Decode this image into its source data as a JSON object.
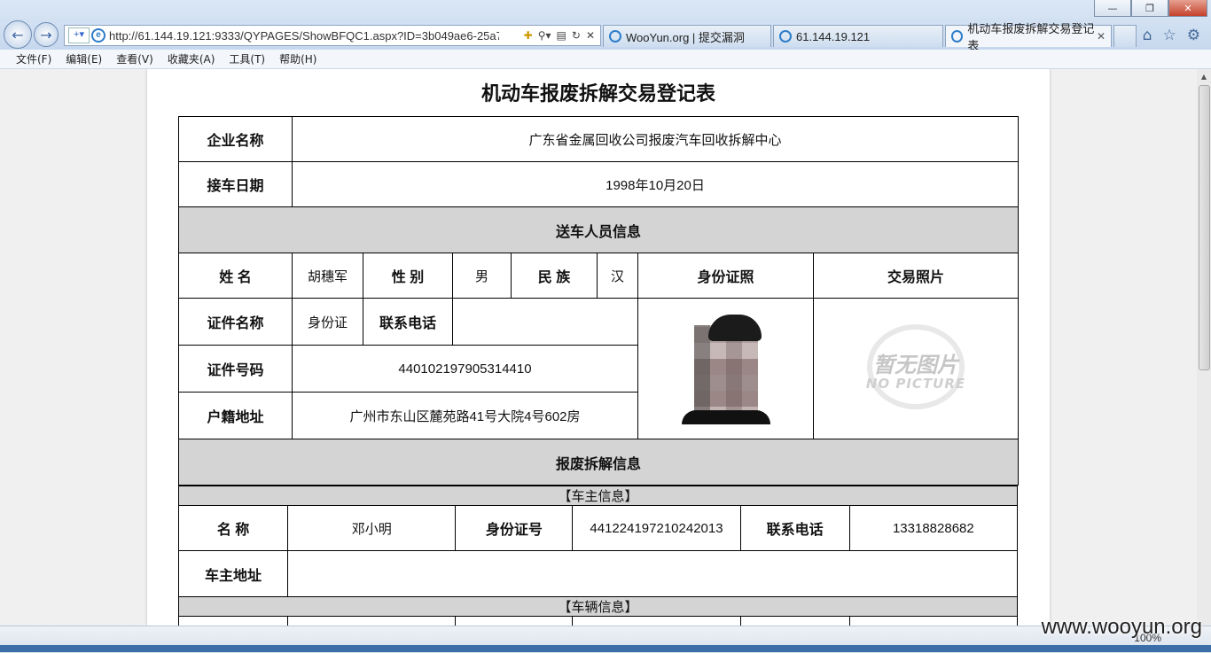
{
  "browser": {
    "url": "http://61.144.19.121:9333/QYPAGES/ShowBFQC1.aspx?ID=3b049ae6-25a7-",
    "tabs": [
      {
        "label": "WooYun.org | 提交漏洞"
      },
      {
        "label": "61.144.19.121"
      },
      {
        "label": "机动车报废拆解交易登记表"
      }
    ],
    "menu": [
      "文件(F)",
      "编辑(E)",
      "查看(V)",
      "收藏夹(A)",
      "工具(T)",
      "帮助(H)"
    ],
    "zoom": "100%"
  },
  "document": {
    "title": "机动车报废拆解交易登记表",
    "company_label": "企业名称",
    "company_value": "广东省金属回收公司报废汽车回收拆解中心",
    "date_label": "接车日期",
    "date_value": "1998年10月20日",
    "sender_section": "送车人员信息",
    "name_label": "姓 名",
    "name_value": "胡穗军",
    "gender_label": "性 别",
    "gender_value": "男",
    "ethnicity_label": "民 族",
    "ethnicity_value": "汉",
    "id_photo_label": "身份证照",
    "trade_photo_label": "交易照片",
    "doc_type_label": "证件名称",
    "doc_type_value": "身份证",
    "phone_label": "联系电话",
    "phone_value": "",
    "doc_number_label": "证件号码",
    "doc_number_value": "440102197905314410",
    "address_label": "户籍地址",
    "address_value": "广州市东山区麓苑路41号大院4号602房",
    "no_picture_cn": "暂无图片",
    "no_picture_en": "NO PICTURE",
    "scrap_section": "报废拆解信息",
    "owner_subsection": "【车主信息】",
    "owner_name_label": "名 称",
    "owner_name_value": "邓小明",
    "owner_id_label": "身份证号",
    "owner_id_value": "441224197210242013",
    "owner_phone_label": "联系电话",
    "owner_phone_value": "13318828682",
    "owner_address_label": "车主地址",
    "owner_address_value": "",
    "vehicle_subsection": "【车辆信息】"
  },
  "watermark": "www.wooyun.org"
}
